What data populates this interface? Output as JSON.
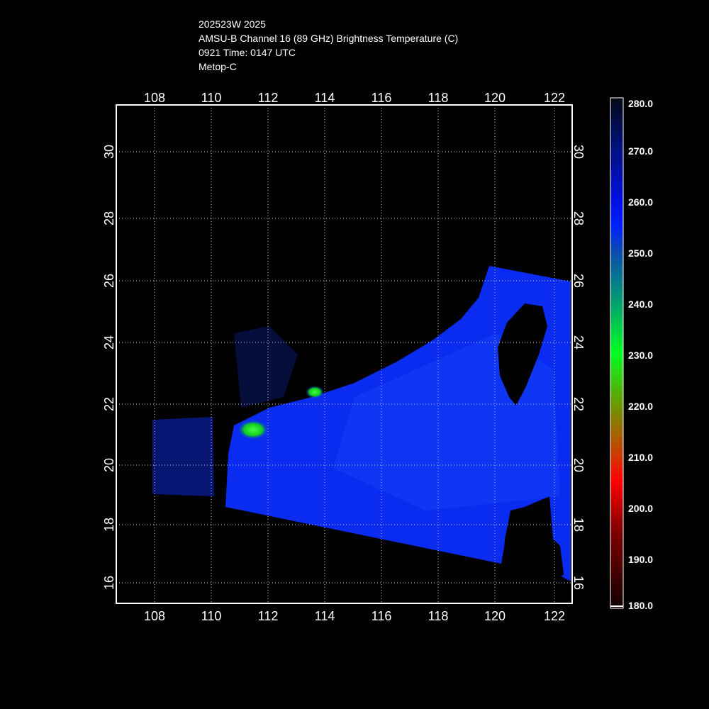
{
  "header": {
    "storm_id": "202523W 2025",
    "product": "AMSU-B Channel 16 (89 GHz) Brightness Temperature (C)",
    "time": "0921 Time: 0147 UTC",
    "satellite": "Metop-C"
  },
  "map": {
    "lon_ticks": [
      "108",
      "110",
      "112",
      "114",
      "116",
      "118",
      "120",
      "122"
    ],
    "lat_ticks": [
      "16",
      "18",
      "20",
      "22",
      "24",
      "26",
      "28",
      "30"
    ],
    "lon_range": [
      106.7,
      122.6
    ],
    "lat_range": [
      15.5,
      31.5
    ],
    "colors": {
      "swath": "#0a2cf0",
      "swath_light": "#1a4aff",
      "convection": "#11dd22"
    }
  },
  "colorbar": {
    "labels": [
      "280.0",
      "270.0",
      "260.0",
      "250.0",
      "240.0",
      "230.0",
      "220.0",
      "210.0",
      "200.0",
      "190.0",
      "180.0"
    ],
    "range": [
      180,
      280
    ]
  }
}
